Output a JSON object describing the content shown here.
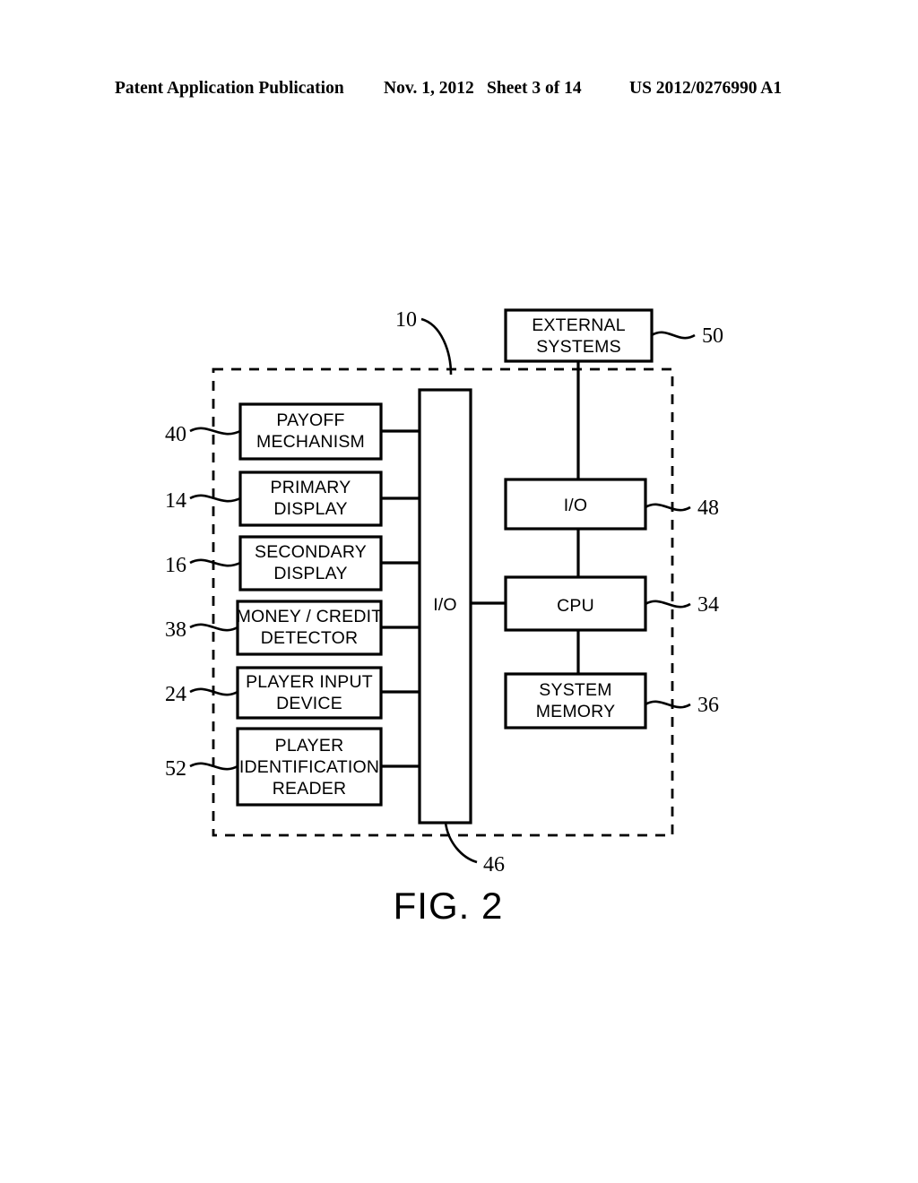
{
  "header": {
    "publication": "Patent Application Publication",
    "date": "Nov. 1, 2012",
    "sheet": "Sheet 3 of 14",
    "number": "US 2012/0276990 A1"
  },
  "figure": {
    "caption": "FIG. 2",
    "enclosure_ref": "10",
    "bus_ref": "46",
    "bus_label": "I/O",
    "left_components": [
      {
        "ref": "40",
        "lines": [
          "PAYOFF",
          "MECHANISM"
        ]
      },
      {
        "ref": "14",
        "lines": [
          "PRIMARY",
          "DISPLAY"
        ]
      },
      {
        "ref": "16",
        "lines": [
          "SECONDARY",
          "DISPLAY"
        ]
      },
      {
        "ref": "38",
        "lines": [
          "MONEY / CREDIT",
          "DETECTOR"
        ]
      },
      {
        "ref": "24",
        "lines": [
          "PLAYER  INPUT",
          "DEVICE"
        ]
      },
      {
        "ref": "52",
        "lines": [
          "PLAYER",
          "IDENTIFICATION",
          "READER"
        ]
      }
    ],
    "right_components": [
      {
        "ref": "50",
        "lines": [
          "EXTERNAL",
          "SYSTEMS"
        ]
      },
      {
        "ref": "48",
        "lines": [
          "I/O"
        ]
      },
      {
        "ref": "34",
        "lines": [
          "CPU"
        ]
      },
      {
        "ref": "36",
        "lines": [
          "SYSTEM",
          "MEMORY"
        ]
      }
    ]
  }
}
